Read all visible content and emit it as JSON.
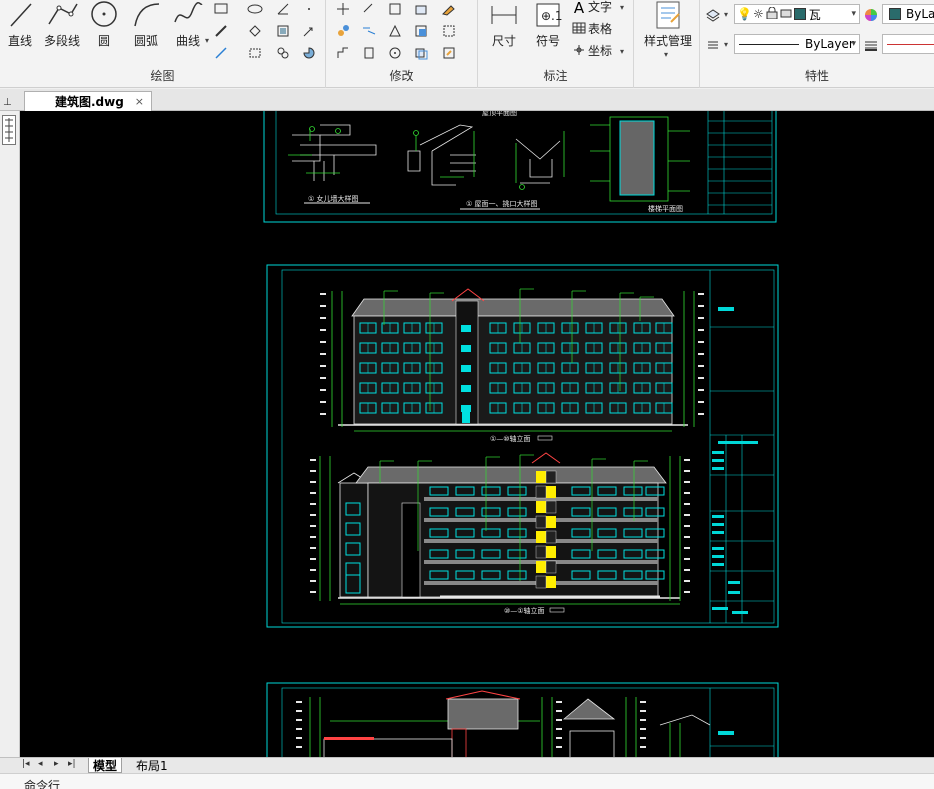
{
  "ribbon": {
    "draw_panel": {
      "title": "绘图",
      "tools": [
        {
          "name": "line",
          "label": "直线"
        },
        {
          "name": "polyline",
          "label": "多段线"
        },
        {
          "name": "circle",
          "label": "圆"
        },
        {
          "name": "arc",
          "label": "圆弧"
        },
        {
          "name": "curve",
          "label": "曲线"
        }
      ]
    },
    "modify_panel": {
      "title": "修改"
    },
    "annotation_panel": {
      "title": "标注",
      "dimension_label": "尺寸",
      "symbol_label": "符号",
      "text_label": "文字",
      "table_label": "表格",
      "coord_label": "坐标"
    },
    "style_panel": {
      "label": "样式管理"
    },
    "properties_panel": {
      "title": "特性",
      "layer_value": "瓦",
      "color_value": "ByLa",
      "linetype_value": "ByLayer"
    }
  },
  "document_tab": {
    "label": "建筑图.dwg",
    "close_glyph": "×"
  },
  "layout_tabs": [
    {
      "label": "模型",
      "active": true
    },
    {
      "label": "布局1",
      "active": false
    }
  ],
  "command_line": {
    "text": "命令行"
  },
  "colors": {
    "canvas_bg": "#000000",
    "frame": "#00d8d8",
    "green_lines": "#33dd33",
    "windows": "#00e0e0",
    "yellow_accent": "#ffee00",
    "roof": "#8a8a8a",
    "red_accent": "#ff4444"
  }
}
